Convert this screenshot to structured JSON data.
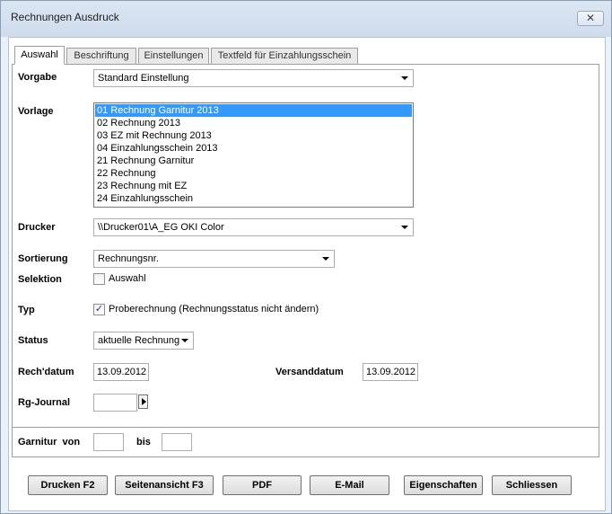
{
  "window": {
    "title": "Rechnungen Ausdruck",
    "close_glyph": "✕"
  },
  "tabs": [
    {
      "label": "Auswahl",
      "active": true
    },
    {
      "label": "Beschriftung",
      "active": false
    },
    {
      "label": "Einstellungen",
      "active": false
    },
    {
      "label": "Textfeld für Einzahlungsschein",
      "active": false
    }
  ],
  "form": {
    "vorgabe": {
      "label": "Vorgabe",
      "value": "Standard Einstellung"
    },
    "vorlage": {
      "label": "Vorlage",
      "items": [
        "01 Rechnung Garnitur 2013",
        "02 Rechnung 2013",
        "03 EZ mit Rechnung 2013",
        "04 Einzahlungsschein 2013",
        "21 Rechnung Garnitur",
        "22 Rechnung",
        "23 Rechnung mit EZ",
        "24 Einzahlungsschein"
      ],
      "selected_index": 0
    },
    "drucker": {
      "label": "Drucker",
      "value": "\\\\Drucker01\\A_EG OKI Color"
    },
    "sortierung": {
      "label": "Sortierung",
      "value": "Rechnungsnr."
    },
    "selektion": {
      "label": "Selektion",
      "checkbox_label": "Auswahl",
      "checked": false
    },
    "typ": {
      "label": "Typ",
      "checkbox_label": "Proberechnung (Rechnungsstatus nicht ändern)",
      "checked": true
    },
    "status": {
      "label": "Status",
      "value": "aktuelle Rechnung"
    },
    "rechdatum": {
      "label": "Rech'datum",
      "value": "13.09.2012"
    },
    "versanddatum": {
      "label": "Versanddatum",
      "value": "13.09.2012"
    },
    "rgjournal": {
      "label": "Rg-Journal",
      "value": ""
    },
    "garnitur": {
      "label": "Garnitur  von",
      "von": "",
      "bis_label": "bis",
      "bis": ""
    }
  },
  "check_glyph": "✓",
  "buttons": {
    "drucken": "Drucken F2",
    "seitenansicht": "Seitenansicht F3",
    "pdf": "PDF",
    "email": "E-Mail",
    "eigenschaften": "Eigenschaften",
    "schliessen": "Schliessen"
  }
}
